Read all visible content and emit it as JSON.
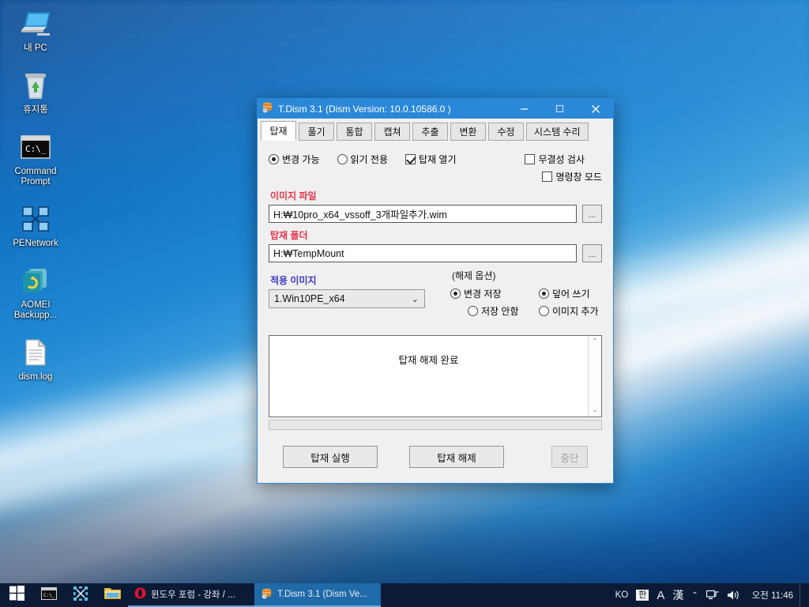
{
  "desktop": {
    "icons": [
      {
        "name": "my-pc",
        "label": "내 PC",
        "icon": "computer-icon"
      },
      {
        "name": "recycle-bin",
        "label": "휴지통",
        "icon": "recycle-bin-icon"
      },
      {
        "name": "command-prompt",
        "label": "Command Prompt",
        "icon": "console-icon"
      },
      {
        "name": "penetwork",
        "label": "PENetwork",
        "icon": "network-icon"
      },
      {
        "name": "aomei-backupper",
        "label": "AOMEI Backupp...",
        "icon": "backup-icon"
      },
      {
        "name": "dism-log",
        "label": "dism.log",
        "icon": "text-file-icon"
      }
    ]
  },
  "window": {
    "title": "T.Dism 3.1 (Dism Version: 10.0.10586.0 )",
    "icon": "package-icon",
    "controls": {
      "minimize": "—",
      "maximize": "❐",
      "close": "✕"
    },
    "accent": "#2b88d8",
    "tabs": [
      {
        "label": "탑재",
        "active": true
      },
      {
        "label": "풀기",
        "active": false
      },
      {
        "label": "통합",
        "active": false
      },
      {
        "label": "캡쳐",
        "active": false
      },
      {
        "label": "추출",
        "active": false
      },
      {
        "label": "변환",
        "active": false
      },
      {
        "label": "수정",
        "active": false
      },
      {
        "label": "시스템 수리",
        "active": false
      }
    ],
    "options_row": {
      "mode_writable": {
        "label": "변경 가능",
        "selected": true
      },
      "mode_readonly": {
        "label": "읽기 전용",
        "selected": false
      },
      "open_mount": {
        "label": "탑재 열기",
        "checked": true
      },
      "integrity_check": {
        "label": "무결성 검사",
        "checked": false
      },
      "cmd_mode": {
        "label": "명령창 모드",
        "checked": false
      }
    },
    "image_file": {
      "label": "이미지 파일",
      "label_color": "#e8344a",
      "value": "H:₩10pro_x64_vssoff_3개파일추가.wim",
      "browse_label": "..."
    },
    "mount_folder": {
      "label": "탑재 폴더",
      "label_color": "#e8344a",
      "value": "H:₩TempMount",
      "browse_label": "..."
    },
    "apply_image": {
      "label": "적용 이미지",
      "label_color": "#3b37c8",
      "selected": "1.Win10PE_x64",
      "chevron": "⌄"
    },
    "unmount_options": {
      "caption": "(해제 옵션)",
      "items": [
        {
          "label": "변경 저장",
          "selected": true
        },
        {
          "label": "덮어 쓰기",
          "selected": true
        },
        {
          "label": "저장 안함",
          "selected": false
        },
        {
          "label": "이미지 추가",
          "selected": false
        }
      ]
    },
    "log": {
      "text": "탑재 해제 완료",
      "scroll_up": "⌃",
      "scroll_down": "⌄"
    },
    "progress": {
      "percent": 0
    },
    "buttons": [
      {
        "name": "mount-run-button",
        "label": "탑재 실행",
        "disabled": false
      },
      {
        "name": "mount-unmount-button",
        "label": "탑재 해제",
        "disabled": false
      },
      {
        "name": "abort-button",
        "label": "중단",
        "disabled": true
      }
    ]
  },
  "taskbar": {
    "start": {
      "name": "start-button",
      "icon": "windows-logo-icon"
    },
    "quick_launch": [
      {
        "name": "cmd",
        "icon": "console-icon"
      },
      {
        "name": "tool",
        "icon": "crosshair-icon"
      },
      {
        "name": "explorer",
        "icon": "folder-icon"
      }
    ],
    "tasks": [
      {
        "name": "opera-window",
        "label": "윈도우 포럼 - 강좌 / ...",
        "icon": "opera-icon",
        "active": false
      },
      {
        "name": "tdism-window",
        "label": "T.Dism 3.1 (Dism Ve...",
        "icon": "package-icon",
        "active": true
      }
    ],
    "tray": {
      "lang": "KO",
      "ime": "한",
      "alpha": "A",
      "hanja": "漢",
      "chevron": "⌃",
      "network": "network-icon",
      "volume": "volume-icon",
      "clock": "오전 11:46"
    }
  }
}
